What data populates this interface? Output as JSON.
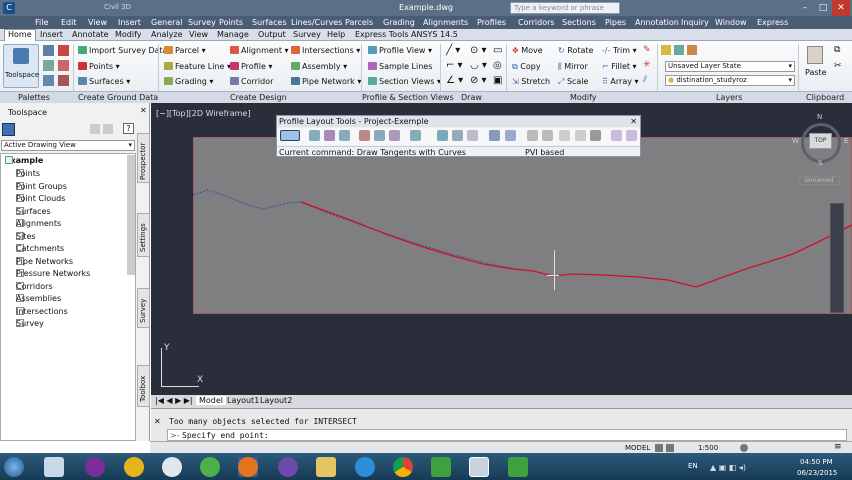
{
  "window": {
    "app_label": "Civil 3D",
    "title": "Example.dwg",
    "search_placeholder": "Type a keyword or phrase"
  },
  "menu": [
    "File",
    "Edit",
    "View",
    "Insert",
    "General",
    "Survey",
    "Points",
    "Surfaces",
    "Lines/Curves",
    "Parcels",
    "Grading",
    "Alignments",
    "Profiles",
    "Corridors",
    "Sections",
    "Pipes",
    "Annotation",
    "Inquiry",
    "Window",
    "Express"
  ],
  "tabs": [
    "Home",
    "Insert",
    "Annotate",
    "Modify",
    "Analyze",
    "View",
    "Manage",
    "Output",
    "Survey",
    "Help",
    "Express Tools",
    "ANSYS 14.5"
  ],
  "ribbon": {
    "toolspace_label": "Toolspace",
    "ground_data": [
      "Import Survey Data",
      "Points",
      "Surfaces"
    ],
    "create_design": [
      "Parcel",
      "Feature Line",
      "Grading",
      "Alignment",
      "Profile",
      "Corridor",
      "Intersections",
      "Assembly",
      "Pipe Network"
    ],
    "profile_section": [
      "Profile View",
      "Sample Lines",
      "Section Views"
    ],
    "modify": [
      "Move",
      "Copy",
      "Stretch",
      "Rotate",
      "Mirror",
      "Scale",
      "Trim",
      "Fillet",
      "Array"
    ],
    "layer_state": "Unsaved Layer State",
    "layer_name": "distination_studyroz",
    "paste_label": "Paste",
    "panels": [
      "Palettes",
      "Create Ground Data",
      "Create Design",
      "Profile & Section Views",
      "Draw",
      "Modify",
      "Layers",
      "Clipboard"
    ]
  },
  "toolspace": {
    "title": "Toolspace",
    "view_select": "Active Drawing View",
    "root": "Example",
    "items": [
      "Points",
      "Point Groups",
      "Point Clouds",
      "Surfaces",
      "Alignments",
      "Sites",
      "Catchments",
      "Pipe Networks",
      "Pressure Networks",
      "Corridors",
      "Assemblies",
      "Intersections",
      "Survey"
    ],
    "side_tabs": [
      "Prospector",
      "Settings",
      "Survey",
      "Toolbox"
    ]
  },
  "viewport": {
    "label": "[−][Top][2D Wireframe]",
    "compass": {
      "n": "N",
      "s": "S",
      "e": "E",
      "w": "W",
      "center": "TOP"
    },
    "wcs": "Unnamed",
    "y_axis": "Y",
    "x_axis": "X",
    "layout_tabs": [
      "Model",
      "Layout1",
      "Layout2"
    ]
  },
  "profile_tools": {
    "title": "Profile Layout Tools - Project-Exemple",
    "current_command": "Current command: Draw Tangents with Curves",
    "mode": "PVI based"
  },
  "command_line": {
    "history": "Too many objects selected for INTERSECT",
    "prompt": "Specify end point:"
  },
  "status_bar": {
    "model": "MODEL",
    "scale": "1:500"
  },
  "taskbar": {
    "lang": "EN",
    "time": "04:50 PM",
    "date": "06/23/2015"
  },
  "colors": {
    "profile_line": "#d0102a",
    "surface_line": "#3a5a9a",
    "profile_bg": "#7f7f81",
    "viewport_bg": "#2a2e3b"
  }
}
